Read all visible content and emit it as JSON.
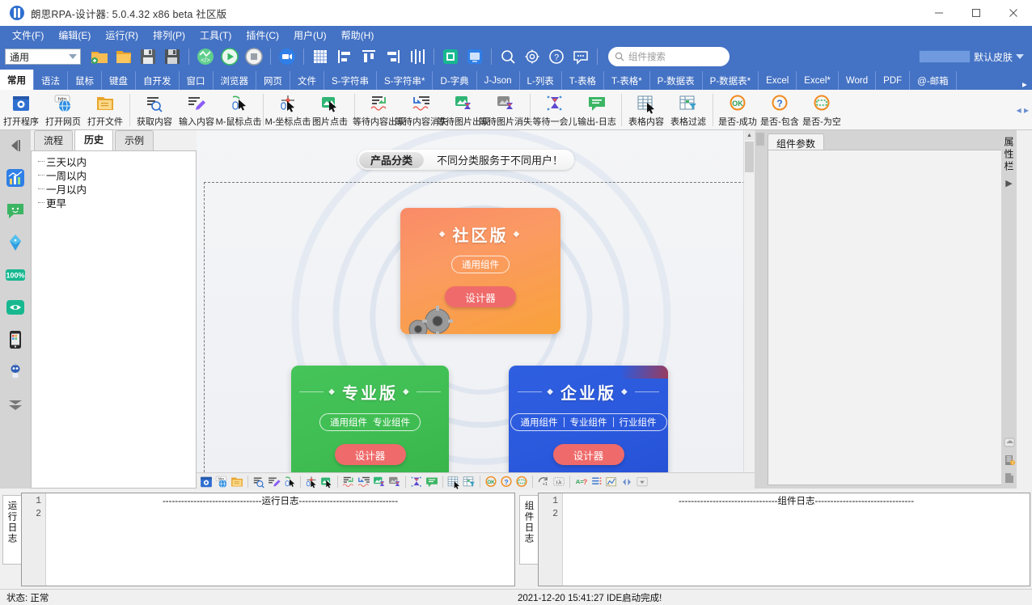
{
  "window": {
    "title": "朗思RPA-设计器: 5.0.4.32 x86 beta 社区版",
    "minimize": "—",
    "maximize": "□",
    "close": "✕"
  },
  "menubar": {
    "items": [
      "文件(F)",
      "编辑(E)",
      "运行(R)",
      "排列(P)",
      "工具(T)",
      "插件(C)",
      "用户(U)",
      "帮助(H)"
    ]
  },
  "toolbar": {
    "combo_value": "通用",
    "search_placeholder": "组件搜索",
    "skin_label": "默认皮肤",
    "icons": [
      "new-folder-icon",
      "open-folder-icon",
      "save-icon",
      "save-as-icon",
      "code-flow-icon",
      "run-icon",
      "stop-icon",
      "record-video-icon",
      "grid-icon",
      "align-left-icon",
      "align-top-icon",
      "align-right-icon",
      "distribute-icon",
      "capture-icon",
      "screen-icon",
      "search-icon",
      "settings-icon",
      "help-icon",
      "feedback-icon"
    ]
  },
  "ribbon_tabs": {
    "items": [
      "常用",
      "语法",
      "鼠标",
      "键盘",
      "自开发",
      "窗口",
      "浏览器",
      "网页",
      "文件",
      "S-字符串",
      "S-字符串*",
      "D-字典",
      "J-Json",
      "L-列表",
      "T-表格",
      "T-表格*",
      "P-数据表",
      "P-数据表*",
      "Excel",
      "Excel*",
      "Word",
      "PDF",
      "@-邮箱"
    ],
    "active": "常用"
  },
  "ribbon_items": [
    {
      "label": "打开程序",
      "icon": "open-program-icon",
      "group": 0
    },
    {
      "label": "打开网页",
      "icon": "open-webpage-icon",
      "group": 0
    },
    {
      "label": "打开文件",
      "icon": "open-file-icon",
      "group": 0
    },
    {
      "label": "获取内容",
      "icon": "get-content-icon",
      "group": 1
    },
    {
      "label": "输入内容",
      "icon": "input-content-icon",
      "group": 1
    },
    {
      "label": "M-鼠标点击",
      "icon": "mouse-click-icon",
      "group": 1
    },
    {
      "label": "M-坐标点击",
      "icon": "coord-click-icon",
      "group": 2
    },
    {
      "label": "图片点击",
      "icon": "image-click-icon",
      "group": 2
    },
    {
      "label": "等待内容出现",
      "icon": "wait-content-appear-icon",
      "group": 3
    },
    {
      "label": "等待内容消失",
      "icon": "wait-content-disappear-icon",
      "group": 3
    },
    {
      "label": "等待图片出现",
      "icon": "wait-image-appear-icon",
      "group": 3
    },
    {
      "label": "等待图片消失",
      "icon": "wait-image-disappear-icon",
      "group": 3
    },
    {
      "label": "等待一会儿",
      "icon": "wait-a-while-icon",
      "group": 4
    },
    {
      "label": "输出-日志",
      "icon": "output-log-icon",
      "group": 4
    },
    {
      "label": "表格内容",
      "icon": "table-content-icon",
      "group": 5
    },
    {
      "label": "表格过滤",
      "icon": "table-filter-icon",
      "group": 5
    },
    {
      "label": "是否-成功",
      "icon": "is-success-icon",
      "group": 6
    },
    {
      "label": "是否-包含",
      "icon": "is-contains-icon",
      "group": 6
    },
    {
      "label": "是否-为空",
      "icon": "is-empty-icon",
      "group": 6
    }
  ],
  "rail_icons": [
    "collapse-left-icon",
    "chart-icon",
    "chat-bubble-icon",
    "fish-icon",
    "zoom-100-icon",
    "eye-icon",
    "mobile-icon",
    "robot-icon",
    "more-down-icon"
  ],
  "left_panel": {
    "tabs": [
      "流程",
      "历史",
      "示例"
    ],
    "active_tab": "历史",
    "tree_items": [
      "三天以内",
      "一周以内",
      "一月以内",
      "更早"
    ]
  },
  "canvas": {
    "banner_pill": "产品分类",
    "banner_text": "不同分类服务于不同用户！",
    "cards": [
      {
        "name": "community",
        "title": "社区版",
        "tags": [
          "通用组件"
        ],
        "button": "设计器",
        "color": "#f9a23a"
      },
      {
        "name": "professional",
        "title": "专业版",
        "tags": [
          "通用组件",
          "专业组件"
        ],
        "button": "设计器",
        "color": "#3fbd52"
      },
      {
        "name": "enterprise",
        "title": "企业版",
        "tags": [
          "通用组件",
          "专业组件",
          "行业组件"
        ],
        "button": "设计器",
        "color": "#2b59dd"
      }
    ],
    "bottom_toolbar_icons": [
      "open-program-icon",
      "open-webpage-icon",
      "open-file-icon",
      "get-content-icon",
      "input-content-icon",
      "mouse-click-icon",
      "coord-click-icon",
      "image-click-icon",
      "wait-content-appear-icon",
      "wait-content-disappear-icon",
      "wait-image-appear-icon",
      "wait-image-disappear-icon",
      "wait-a-while-icon",
      "output-log-icon",
      "table-content-icon",
      "table-filter-icon",
      "is-success-icon",
      "is-contains-icon",
      "is-empty-icon",
      "loop-icon",
      "loop-index-icon",
      "assign-icon",
      "list-icon",
      "chart-var-icon",
      "prev-next-icon",
      "dropdown-icon"
    ]
  },
  "right_panel": {
    "tab": "组件参数",
    "vertical_label": "属性栏",
    "expand_arrow": "▶",
    "dock_icons": [
      "cloud-icon",
      "server-icon",
      "page-icon"
    ]
  },
  "logs": {
    "run": {
      "tab": "运行日志",
      "lines": [
        "--------------------------------运行日志--------------------------------",
        ""
      ],
      "numbers": [
        "1",
        "2"
      ]
    },
    "component": {
      "tab": "组件日志",
      "lines": [
        "--------------------------------组件日志--------------------------------",
        ""
      ],
      "numbers": [
        "1",
        "2"
      ]
    }
  },
  "statusbar": {
    "state": "状态: 正常",
    "message": "2021-12-20 15:41:27 IDE启动完成!"
  }
}
